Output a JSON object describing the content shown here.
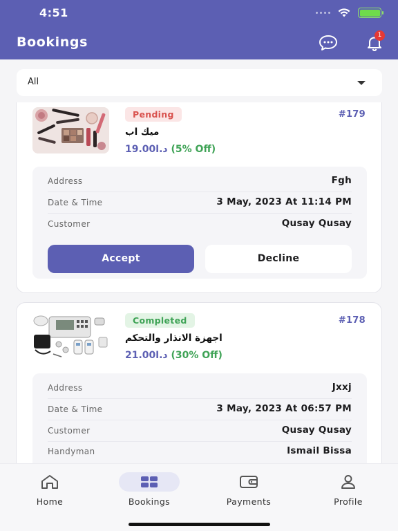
{
  "status_bar": {
    "time": "4:51"
  },
  "header": {
    "title": "Bookings",
    "notification_count": "1"
  },
  "filter": {
    "selected": "All"
  },
  "bookings": [
    {
      "status": "Pending",
      "id": "#179",
      "service": "ميك اب",
      "price": "19.00د.ا",
      "discount": "(5% Off)",
      "details": [
        {
          "label": "Address",
          "value": "Fgh"
        },
        {
          "label": "Date & Time",
          "value": "3 May, 2023 At 11:14 PM"
        },
        {
          "label": "Customer",
          "value": "Qusay Qusay"
        }
      ],
      "accept_label": "Accept",
      "decline_label": "Decline"
    },
    {
      "status": "Completed",
      "id": "#178",
      "service": "اجهزة الانذار والتحكم",
      "price": "21.00د.ا",
      "discount": "(30% Off)",
      "details": [
        {
          "label": "Address",
          "value": "Jxxj"
        },
        {
          "label": "Date & Time",
          "value": "3 May, 2023 At 06:57 PM"
        },
        {
          "label": "Customer",
          "value": "Qusay Qusay"
        },
        {
          "label": "Handyman",
          "value": "Ismail Bissa"
        }
      ]
    }
  ],
  "tabs": [
    {
      "label": "Home",
      "icon": "home-icon"
    },
    {
      "label": "Bookings",
      "icon": "bookings-icon"
    },
    {
      "label": "Payments",
      "icon": "wallet-icon"
    },
    {
      "label": "Profile",
      "icon": "profile-icon"
    }
  ],
  "colors": {
    "primary": "#5c5fb3",
    "pending": "#d9534f",
    "completed": "#3fa356"
  }
}
